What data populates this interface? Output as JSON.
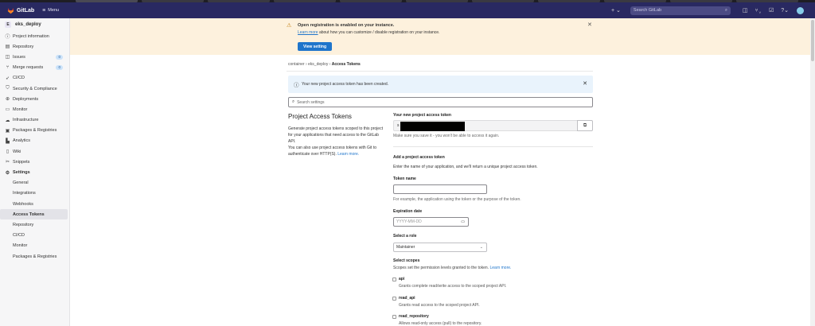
{
  "header": {
    "brand": "GitLab",
    "menu_label": "Menu",
    "new_label": "+ ⌄",
    "search_placeholder": "Search GitLab"
  },
  "sidebar": {
    "project_letter": "E",
    "project_name": "eks_deploy",
    "items": [
      {
        "label": "Project information",
        "icon": "info-icon"
      },
      {
        "label": "Repository",
        "icon": "book-icon"
      },
      {
        "label": "Issues",
        "icon": "issues-icon",
        "badge": "0"
      },
      {
        "label": "Merge requests",
        "icon": "merge-request-icon",
        "badge": "0"
      },
      {
        "label": "CI/CD",
        "icon": "rocket-icon"
      },
      {
        "label": "Security & Compliance",
        "icon": "shield-icon"
      },
      {
        "label": "Deployments",
        "icon": "deployments-icon"
      },
      {
        "label": "Monitor",
        "icon": "monitor-icon"
      },
      {
        "label": "Infrastructure",
        "icon": "cloud-icon"
      },
      {
        "label": "Packages & Registries",
        "icon": "package-icon"
      },
      {
        "label": "Analytics",
        "icon": "chart-icon"
      },
      {
        "label": "Wiki",
        "icon": "wiki-icon"
      },
      {
        "label": "Snippets",
        "icon": "snippet-icon"
      },
      {
        "label": "Settings",
        "icon": "settings-icon"
      }
    ],
    "settings_sub": [
      "General",
      "Integrations",
      "Webhooks",
      "Access Tokens",
      "Repository",
      "CI/CD",
      "Monitor",
      "Packages & Registries"
    ],
    "active_sub": "Access Tokens"
  },
  "banner": {
    "title": "Open registration is enabled on your instance.",
    "link_text": "Learn more",
    "desc_rest": " about how you can customize / disable registration on your instance.",
    "button": "View setting"
  },
  "breadcrumb": {
    "items": [
      "container",
      "eks_deploy"
    ],
    "current": "Access Tokens",
    "separator": "›"
  },
  "alert": {
    "message": "Your new project access token has been created."
  },
  "search_settings": {
    "placeholder": "Search settings"
  },
  "section": {
    "title": "Project Access Tokens",
    "desc": "Generate project access tokens scoped to this project for your applications that need access to the GitLab API.",
    "desc2": "You can also use project access tokens with Git to authenticate over HTTP(S). ",
    "learn_more": "Learn more."
  },
  "new_token": {
    "label": "Your new project access token",
    "prefix": "s",
    "help": "Make sure you save it - you won't be able to access it again."
  },
  "add_token": {
    "heading": "Add a project access token",
    "intro": "Enter the name of your application, and we'll return a unique project access token.",
    "name_label": "Token name",
    "name_help": "For example, the application using the token or the purpose of the token.",
    "expiration_label": "Expiration date",
    "expiration_placeholder": "YYYY-MM-DD",
    "role_label": "Select a role",
    "role_value": "Maintainer",
    "scopes_label": "Select scopes",
    "scopes_help": "Scopes set the permission levels granted to the token. ",
    "scopes_learn_more": "Learn more.",
    "scopes": [
      {
        "name": "api",
        "desc": "Grants complete read/write access to the scoped project API."
      },
      {
        "name": "read_api",
        "desc": "Grants read access to the scoped project API."
      },
      {
        "name": "read_repository",
        "desc": "Allows read-only access (pull) to the repository."
      }
    ]
  },
  "colors": {
    "header_bg": "#292961",
    "banner_bg": "#fdf1dd",
    "alert_bg": "#e9f3fc",
    "primary": "#1f75cb"
  }
}
